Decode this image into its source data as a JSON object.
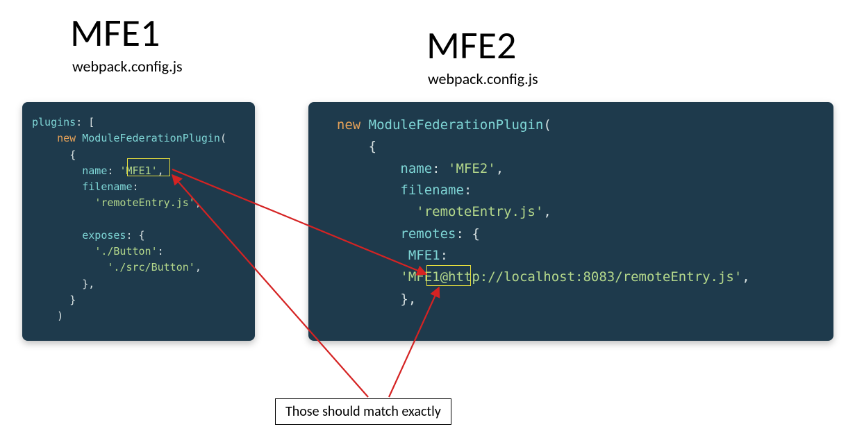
{
  "left": {
    "title": "MFE1",
    "subtitle": "webpack.config.js"
  },
  "right": {
    "title": "MFE2",
    "subtitle": "webpack.config.js"
  },
  "code1": {
    "l1a": "plugins",
    "l1b": ": [",
    "l2a": "new",
    "l2b": " ModuleFederationPlugin",
    "l2c": "(",
    "l3": "{",
    "l4a": "name",
    "l4b": ": ",
    "l4c": "'MFE1'",
    "l4d": ",",
    "l5a": "filename",
    "l5b": ":",
    "l6a": "'remoteEntry.js'",
    "l6b": ",",
    "l7a": "exposes",
    "l7b": ": {",
    "l8a": "'./Button'",
    "l8b": ":",
    "l9a": "'./src/Button'",
    "l9b": ",",
    "l10": "},",
    "l11": "}",
    "l12": ")"
  },
  "code2": {
    "l1a": "new",
    "l1b": " ModuleFederationPlugin",
    "l1c": "(",
    "l2": "{",
    "l3a": "name",
    "l3b": ": ",
    "l3c": "'MFE2'",
    "l3d": ",",
    "l4a": "filename",
    "l4b": ":",
    "l5a": "'remoteEntry.js'",
    "l5b": ",",
    "l6a": "remotes",
    "l6b": ": {",
    "l7a": "MFE1",
    "l7b": ":",
    "l8a": "'MFE1@http://localhost:8083/remoteEntry.js'",
    "l8b": ",",
    "l9": "},"
  },
  "note": "Those should match exactly"
}
